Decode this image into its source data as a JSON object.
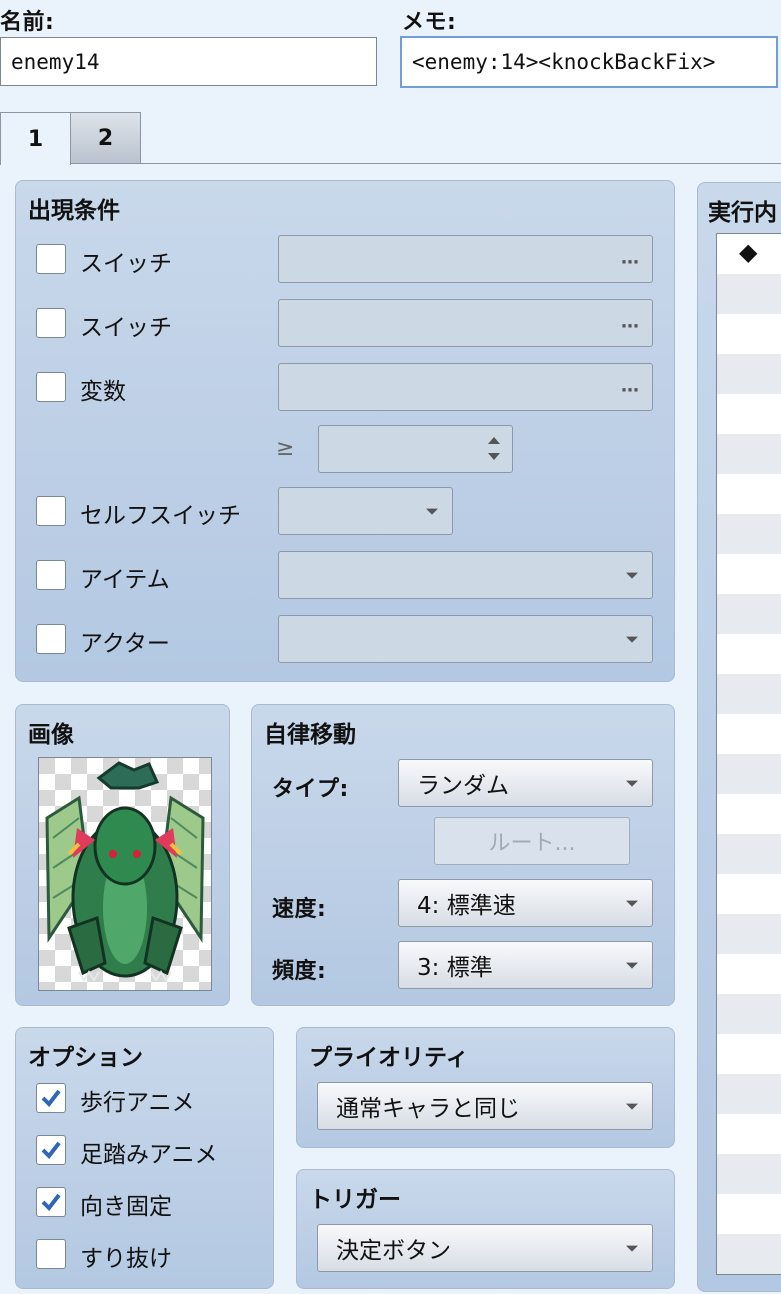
{
  "header": {
    "name_label": "名前:",
    "name_value": "enemy14",
    "memo_label": "メモ:",
    "memo_value": "<enemy:14><knockBackFix>"
  },
  "tabs": [
    {
      "label": "1",
      "active": true
    },
    {
      "label": "2",
      "active": false
    }
  ],
  "conditions": {
    "title": "出現条件",
    "switch1_label": "スイッチ",
    "switch2_label": "スイッチ",
    "variable_label": "変数",
    "compare_symbol": "≥",
    "self_switch_label": "セルフスイッチ",
    "item_label": "アイテム",
    "actor_label": "アクター",
    "ellipsis": "…"
  },
  "image_panel": {
    "title": "画像"
  },
  "autonomous_movement": {
    "title": "自律移動",
    "type_label": "タイプ:",
    "type_value": "ランダム",
    "route_button": "ルート...",
    "speed_label": "速度:",
    "speed_value": "4: 標準速",
    "frequency_label": "頻度:",
    "frequency_value": "3: 標準"
  },
  "options": {
    "title": "オプション",
    "items": [
      {
        "label": "歩行アニメ",
        "checked": true
      },
      {
        "label": "足踏みアニメ",
        "checked": true
      },
      {
        "label": "向き固定",
        "checked": true
      },
      {
        "label": "すり抜け",
        "checked": false
      }
    ]
  },
  "priority": {
    "title": "プライオリティ",
    "value": "通常キャラと同じ"
  },
  "trigger": {
    "title": "トリガー",
    "value": "決定ボタン"
  },
  "execution": {
    "title": "実行内",
    "first_row_marker": "◆"
  },
  "colors": {
    "background": "#eaf2fb",
    "panel": "#bfd1e8",
    "check": "#2f66b5"
  }
}
